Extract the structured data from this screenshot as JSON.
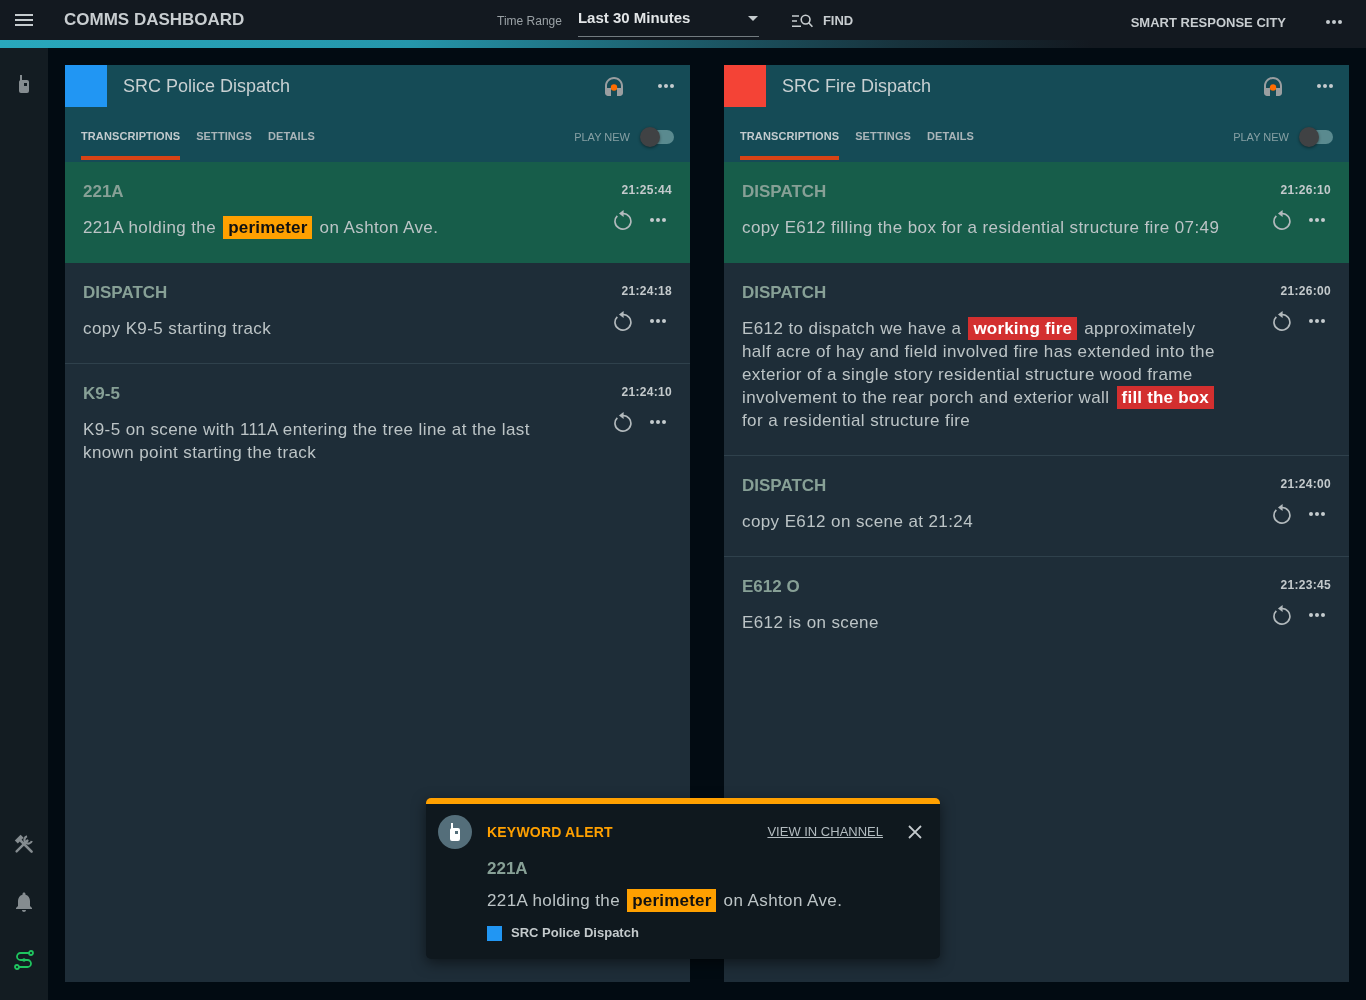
{
  "topbar": {
    "title": "COMMS DASHBOARD",
    "time_range": {
      "label": "Time Range",
      "value": "Last 30 Minutes"
    },
    "find": "FIND",
    "organization": "SMART RESPONSE CITY"
  },
  "sidebar": {
    "top_items": [
      {
        "kind": "radio",
        "selected": false
      }
    ],
    "bottom_items": [
      {
        "kind": "tools",
        "selected": false
      },
      {
        "kind": "bell",
        "selected": false
      },
      {
        "kind": "route",
        "selected": true
      }
    ]
  },
  "channels": [
    {
      "name": "SRC Police Dispatch",
      "color": "#2196f3",
      "keyword": {
        "color": "#ffa000"
      },
      "tabs": [
        {
          "label": "TRANSCRIPTIONS",
          "selected": true
        },
        {
          "label": "SETTINGS",
          "selected": false
        },
        {
          "label": "DETAILS",
          "selected": false
        }
      ],
      "play_new": {
        "label": "PLAY NEW",
        "on": false
      },
      "transcriptions": [
        {
          "speaker": "221A",
          "time": "21:25:44",
          "text": "221A holding the **perimeter** on Ashton Ave.",
          "selected": true
        },
        {
          "speaker": "DISPATCH",
          "time": "21:24:18",
          "text": "copy K9-5 starting track",
          "selected": false
        },
        {
          "speaker": "K9-5",
          "time": "21:24:10",
          "text": "K9-5 on scene with 111A entering the tree line at the last known point starting the track",
          "selected": false
        }
      ]
    },
    {
      "name": "SRC Fire Dispatch",
      "color": "#f44336",
      "keyword": {
        "color": "#d32f2f"
      },
      "tabs": [
        {
          "label": "TRANSCRIPTIONS",
          "selected": true
        },
        {
          "label": "SETTINGS",
          "selected": false
        },
        {
          "label": "DETAILS",
          "selected": false
        }
      ],
      "play_new": {
        "label": "PLAY NEW",
        "on": false
      },
      "transcriptions": [
        {
          "speaker": "DISPATCH",
          "time": "21:26:10",
          "text": "copy E612 filling the box for a residential structure fire 07:49",
          "selected": true
        },
        {
          "speaker": "DISPATCH",
          "time": "21:26:00",
          "text": "E612 to dispatch we have a **working fire** approximately half acre of hay and field involved fire has extended into the exterior of a single story residential structure wood frame involvement to the rear porch and exterior wall **fill the box** for a residential structure fire",
          "selected": false
        },
        {
          "speaker": "DISPATCH",
          "time": "21:24:00",
          "text": "copy E612 on scene at 21:24",
          "selected": false
        },
        {
          "speaker": "E612 O",
          "time": "21:23:45",
          "text": "E612 is on scene",
          "selected": false
        }
      ]
    }
  ],
  "alert": {
    "title": "KEYWORD ALERT",
    "link": "VIEW IN CHANNEL",
    "color": "#ffa000",
    "speaker": "221A",
    "text": "221A holding the **perimeter** on Ashton Ave.",
    "channel": {
      "name": "SRC Police Dispatch",
      "color": "#2196f3"
    }
  }
}
